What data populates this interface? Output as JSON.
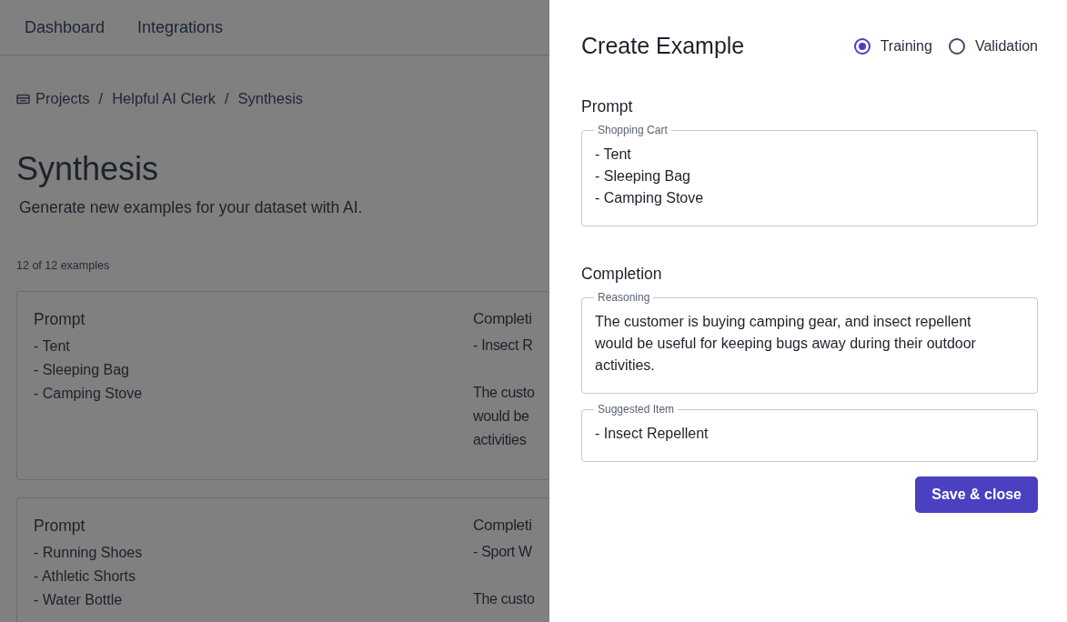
{
  "nav": [
    {
      "label": "Dashboard"
    },
    {
      "label": "Integrations"
    }
  ],
  "breadcrumb": {
    "items": [
      "Projects",
      "Helpful AI Clerk",
      "Synthesis"
    ],
    "separator": "/"
  },
  "page": {
    "title": "Synthesis",
    "subtitle": "Generate new examples for your dataset with AI.",
    "count": "12 of 12 examples"
  },
  "examples": [
    {
      "prompt_heading": "Prompt",
      "prompt_lines": [
        "- Tent",
        "- Sleeping Bag",
        "- Camping Stove"
      ],
      "completion_heading": "Completi",
      "completion_item": "- Insect R",
      "completion_lines": [
        "The custo",
        "would be",
        "activities"
      ]
    },
    {
      "prompt_heading": "Prompt",
      "prompt_lines": [
        "- Running Shoes",
        "- Athletic Shorts",
        "- Water Bottle"
      ],
      "completion_heading": "Completi",
      "completion_item": "- Sport W",
      "completion_lines": [
        "The custo"
      ]
    }
  ],
  "drawer": {
    "title": "Create Example",
    "splits": [
      {
        "label": "Training",
        "selected": true
      },
      {
        "label": "Validation",
        "selected": false
      }
    ],
    "sections": [
      {
        "heading": "Prompt",
        "fields": [
          {
            "label": "Shopping Cart",
            "value": "- Tent\n- Sleeping Bag\n- Camping Stove"
          }
        ]
      },
      {
        "heading": "Completion",
        "fields": [
          {
            "label": "Reasoning",
            "value": "The customer is buying camping gear, and insect repellent would be useful for keeping bugs away during their outdoor activities."
          },
          {
            "label": "Suggested Item",
            "value": "- Insect Repellent"
          }
        ]
      }
    ],
    "button": "Save & close"
  }
}
